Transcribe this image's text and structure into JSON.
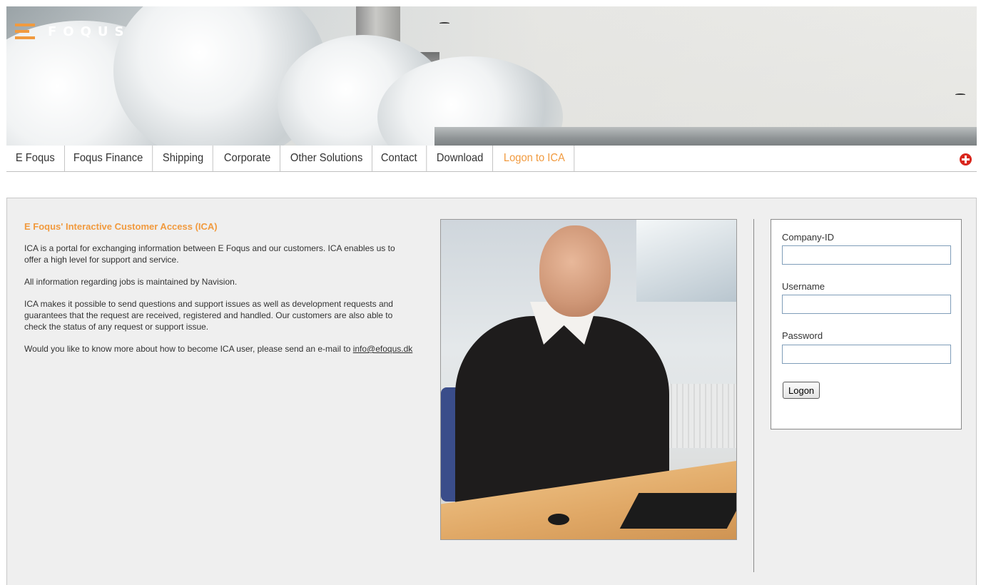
{
  "header": {
    "logo_text": "FOQUS",
    "logo_mark_color": "#f19a3e"
  },
  "nav": {
    "items": [
      {
        "label": "E Foqus",
        "active": false
      },
      {
        "label": "Foqus Finance",
        "active": false
      },
      {
        "label": "Shipping",
        "active": false
      },
      {
        "label": "Corporate",
        "active": false
      },
      {
        "label": "Other Solutions",
        "active": false
      },
      {
        "label": "Contact",
        "active": false
      },
      {
        "label": "Download",
        "active": false
      },
      {
        "label": "Logon to ICA",
        "active": true
      }
    ],
    "expand_icon": "plus-circle-icon",
    "active_color": "#f19a3e"
  },
  "main": {
    "title": "E Foqus' Interactive Customer Access (ICA)",
    "paragraphs": [
      "ICA is a portal for exchanging information between E Foqus and our customers. ICA enables us to offer a high level for support and service.",
      "All information regarding jobs is maintained by Navision.",
      "ICA makes it possible to send questions and support issues as well as development requests and guarantees that the request are received, registered and handled. Our customers are also able to check the status of any request or support issue."
    ],
    "contact_text": "Would you like to know more about how to become ICA user, please send an e-mail to ",
    "contact_email": "info@efoqus.dk"
  },
  "login": {
    "company_label": "Company-ID",
    "company_value": "",
    "username_label": "Username",
    "username_value": "",
    "password_label": "Password",
    "password_value": "",
    "submit_label": "Logon"
  }
}
